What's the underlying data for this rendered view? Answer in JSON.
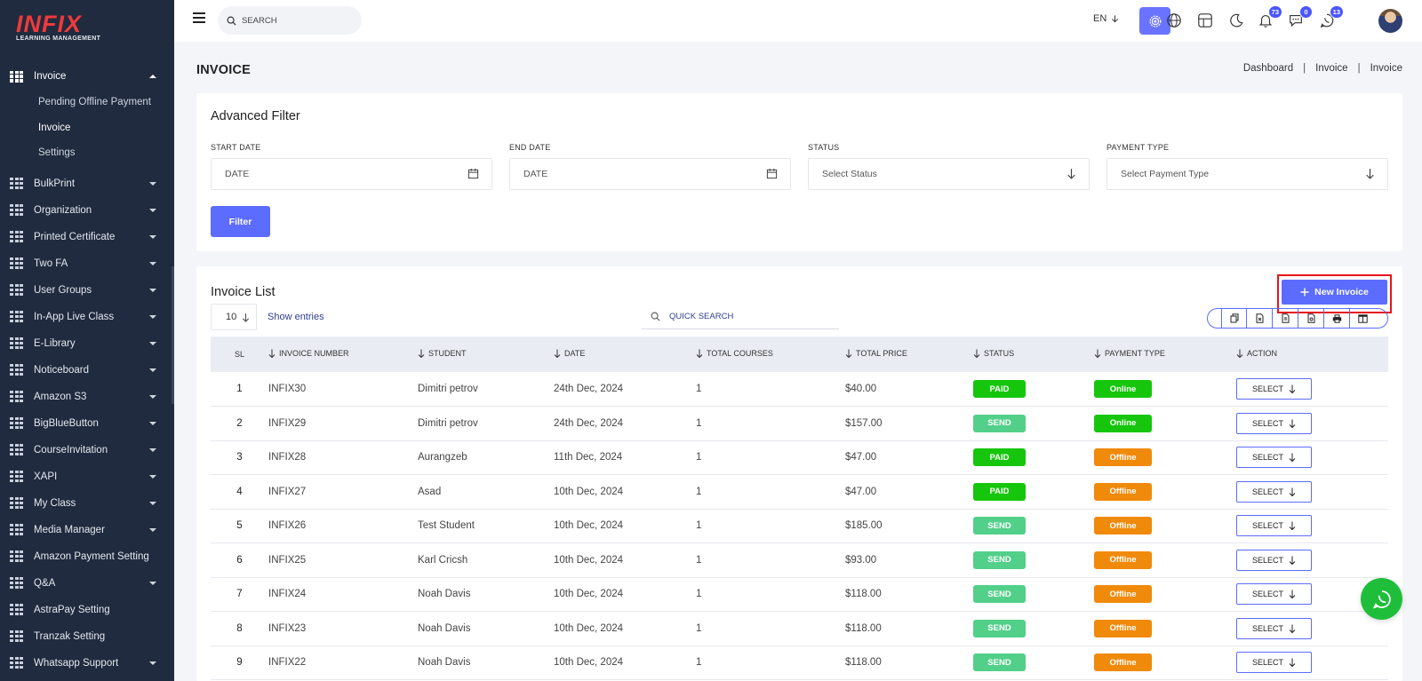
{
  "logo": {
    "brand": "INFIX",
    "tagline": "LEARNING MANAGEMENT"
  },
  "sidebar": {
    "items": [
      {
        "label": "Invoice",
        "active": true,
        "expanded": true,
        "sub": [
          {
            "label": "Pending Offline Payment",
            "active": false
          },
          {
            "label": "Invoice",
            "active": true
          },
          {
            "label": "Settings",
            "active": false
          }
        ]
      },
      {
        "label": "BulkPrint",
        "caret": true
      },
      {
        "label": "Organization",
        "caret": true
      },
      {
        "label": "Printed Certificate",
        "caret": true
      },
      {
        "label": "Two FA",
        "caret": true
      },
      {
        "label": "User Groups",
        "caret": true
      },
      {
        "label": "In-App Live Class",
        "caret": true
      },
      {
        "label": "E-Library",
        "caret": true
      },
      {
        "label": "Noticeboard",
        "caret": true
      },
      {
        "label": "Amazon S3",
        "caret": true
      },
      {
        "label": "BigBlueButton",
        "caret": true
      },
      {
        "label": "CourseInvitation",
        "caret": true
      },
      {
        "label": "XAPI",
        "caret": true
      },
      {
        "label": "My Class",
        "caret": true
      },
      {
        "label": "Media Manager",
        "caret": true
      },
      {
        "label": "Amazon Payment Setting",
        "caret": false
      },
      {
        "label": "Q&A",
        "caret": true
      },
      {
        "label": "AstraPay Setting",
        "caret": false
      },
      {
        "label": "Tranzak Setting",
        "caret": false
      },
      {
        "label": "Whatsapp Support",
        "caret": true
      }
    ]
  },
  "topbar": {
    "search_placeholder": "SEARCH",
    "language": "EN",
    "notifications_count": "73",
    "messages_count": "0",
    "whatsapp_count": "13"
  },
  "page": {
    "title": "INVOICE",
    "breadcrumb": [
      "Dashboard",
      "Invoice",
      "Invoice"
    ]
  },
  "filter": {
    "title": "Advanced Filter",
    "start_date_label": "START DATE",
    "start_date_placeholder": "DATE",
    "end_date_label": "END DATE",
    "end_date_placeholder": "DATE",
    "status_label": "STATUS",
    "status_value": "Select Status",
    "payment_type_label": "PAYMENT TYPE",
    "payment_type_value": "Select Payment Type",
    "button": "Filter"
  },
  "list": {
    "title": "Invoice List",
    "new_button": "New Invoice",
    "entries": "10",
    "show_entries": "Show entries",
    "quick_search_placeholder": "QUICK SEARCH",
    "columns": [
      "SL",
      "INVOICE NUMBER",
      "STUDENT",
      "DATE",
      "TOTAL COURSES",
      "TOTAL PRICE",
      "STATUS",
      "PAYMENT TYPE",
      "ACTION"
    ],
    "action_label": "SELECT",
    "rows": [
      {
        "sl": "1",
        "invoice": "INFIX30",
        "student": "Dimitri petrov",
        "date": "24th Dec, 2024",
        "courses": "1",
        "price": "$40.00",
        "status": "PAID",
        "type": "Online"
      },
      {
        "sl": "2",
        "invoice": "INFIX29",
        "student": "Dimitri petrov",
        "date": "24th Dec, 2024",
        "courses": "1",
        "price": "$157.00",
        "status": "SEND",
        "type": "Online"
      },
      {
        "sl": "3",
        "invoice": "INFIX28",
        "student": "Aurangzeb",
        "date": "11th Dec, 2024",
        "courses": "1",
        "price": "$47.00",
        "status": "PAID",
        "type": "Offline"
      },
      {
        "sl": "4",
        "invoice": "INFIX27",
        "student": "Asad",
        "date": "10th Dec, 2024",
        "courses": "1",
        "price": "$47.00",
        "status": "PAID",
        "type": "Offline"
      },
      {
        "sl": "5",
        "invoice": "INFIX26",
        "student": "Test Student",
        "date": "10th Dec, 2024",
        "courses": "1",
        "price": "$185.00",
        "status": "SEND",
        "type": "Offline"
      },
      {
        "sl": "6",
        "invoice": "INFIX25",
        "student": "Karl Cricsh",
        "date": "10th Dec, 2024",
        "courses": "1",
        "price": "$93.00",
        "status": "SEND",
        "type": "Offline"
      },
      {
        "sl": "7",
        "invoice": "INFIX24",
        "student": "Noah Davis",
        "date": "10th Dec, 2024",
        "courses": "1",
        "price": "$118.00",
        "status": "SEND",
        "type": "Offline"
      },
      {
        "sl": "8",
        "invoice": "INFIX23",
        "student": "Noah Davis",
        "date": "10th Dec, 2024",
        "courses": "1",
        "price": "$118.00",
        "status": "SEND",
        "type": "Offline"
      },
      {
        "sl": "9",
        "invoice": "INFIX22",
        "student": "Noah Davis",
        "date": "10th Dec, 2024",
        "courses": "1",
        "price": "$118.00",
        "status": "SEND",
        "type": "Offline"
      }
    ]
  },
  "colors": {
    "sidebar_bg": "#202b3f",
    "accent": "#5c6cff",
    "paid": "#16c60c",
    "send": "#52cf89",
    "online": "#16c60c",
    "offline": "#f08a0b",
    "highlight": "#e8141a"
  }
}
